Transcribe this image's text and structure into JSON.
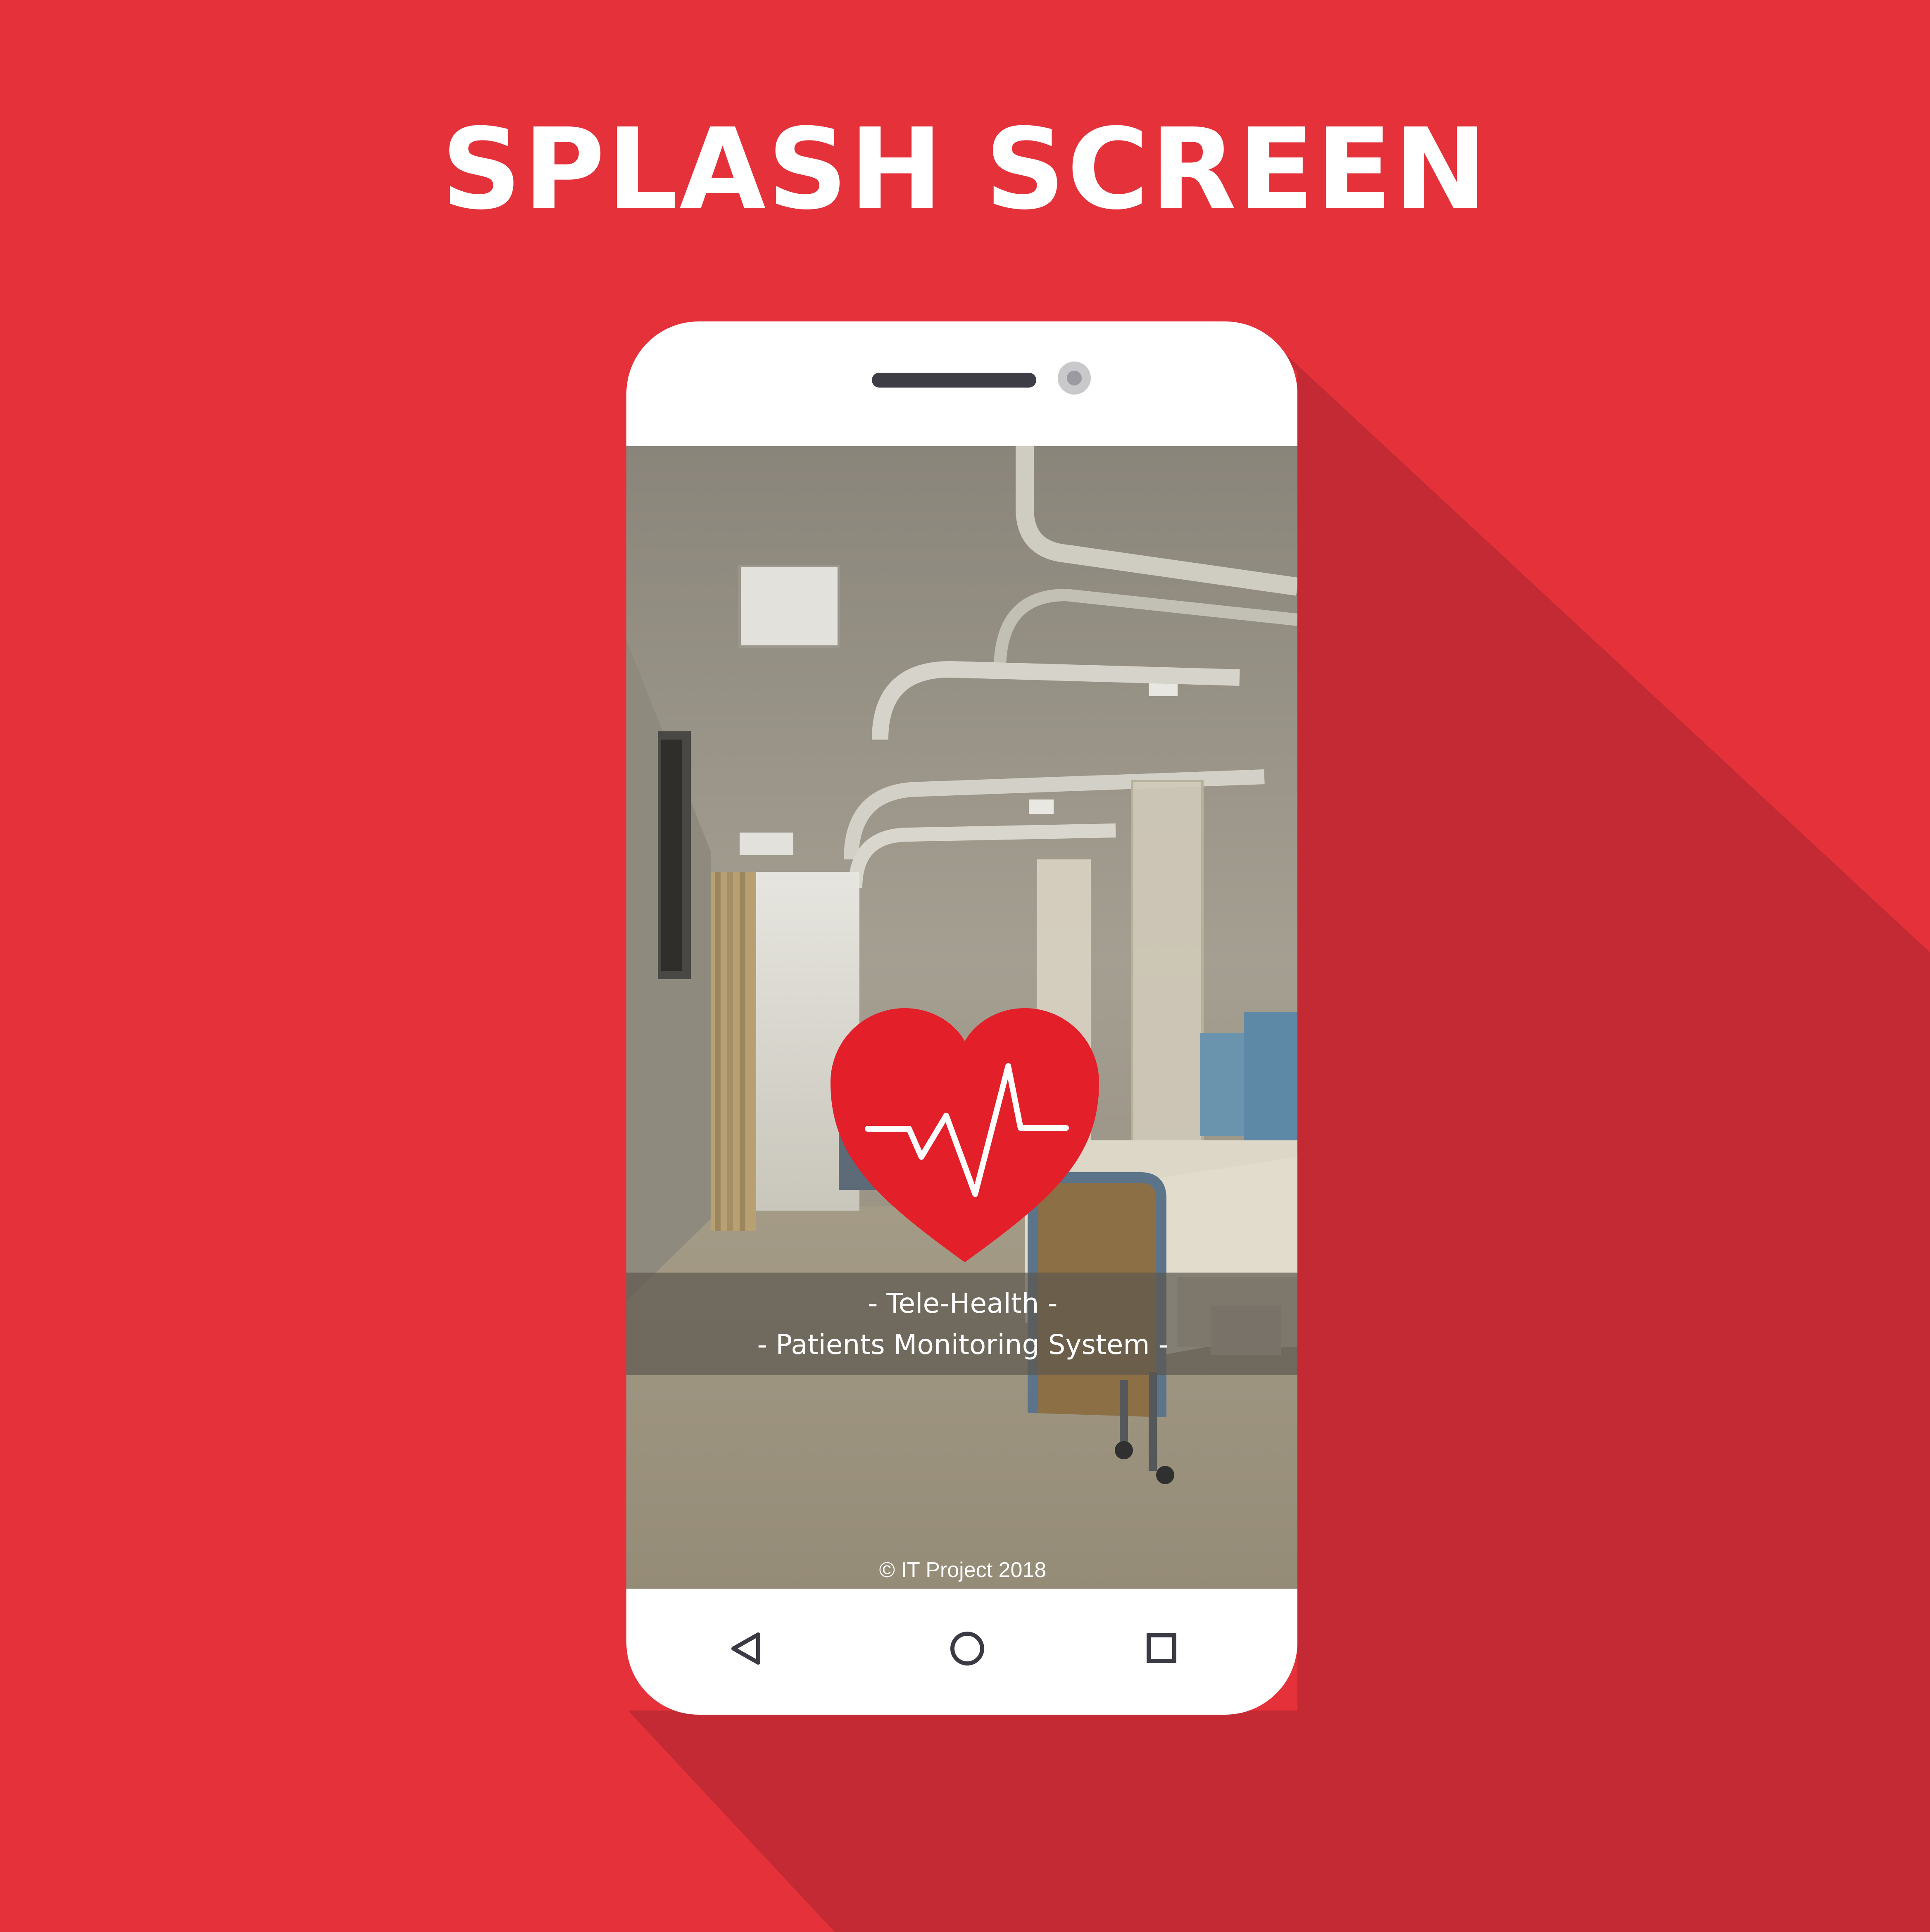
{
  "heading": "SPLASH SCREEN",
  "app": {
    "title_line": "- Tele-Health -",
    "subtitle_line": "- Patients Monitoring System -",
    "copyright": "© IT Project 2018"
  },
  "nav": {
    "back_icon": "back-triangle-icon",
    "home_icon": "home-circle-icon",
    "recents_icon": "recents-square-icon"
  },
  "colors": {
    "background": "#e5323a",
    "shadow": "#c42a33",
    "heart": "#e3202a",
    "phone_frame": "#ffffff",
    "nav_icon": "#3a3a44"
  }
}
